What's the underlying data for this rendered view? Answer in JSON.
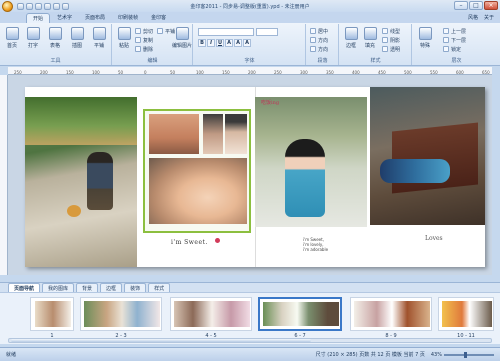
{
  "window": {
    "title": "金印客2011 - 同步易-调整版(重置).ypd - 未注册用户",
    "minimize": "–",
    "maximize": "□",
    "close": "×"
  },
  "tabs": [
    {
      "label": "开始",
      "active": true
    },
    {
      "label": "艺术字",
      "active": false
    },
    {
      "label": "页面布局",
      "active": false
    },
    {
      "label": "印刷装帧",
      "active": false
    },
    {
      "label": "金印客",
      "active": false
    }
  ],
  "tab_right": {
    "style": "风格",
    "about": "关于"
  },
  "ribbon": {
    "groups": {
      "tools": "工具",
      "edit": "编辑",
      "font": "字体",
      "paragraph": "段落",
      "style": "样式",
      "layer": "层次"
    },
    "buttons": {
      "home": "首页",
      "print": "打字",
      "table": "表格",
      "image": "插图",
      "flat": "平铺",
      "paste": "粘贴",
      "cut": "剪切",
      "copy": "复制",
      "delete": "删除",
      "tile": "平铺",
      "edit_image": "编辑图片",
      "center": "居中",
      "left": "方向",
      "right": "方向",
      "border": "边框",
      "fill": "填充",
      "line": "线型",
      "shadow": "阴影",
      "opacity": "透明",
      "special": "特殊",
      "up": "上一层",
      "down": "下一层",
      "lock": "锁定",
      "more": "更多"
    },
    "font_family": "",
    "font_size": ""
  },
  "ruler": {
    "ticks": [
      "250",
      "200",
      "150",
      "100",
      "50",
      "0",
      "50",
      "100",
      "150",
      "200",
      "250",
      "300",
      "350",
      "400",
      "450",
      "500",
      "550",
      "600",
      "650"
    ]
  },
  "canvas": {
    "heading_center": "吃饭ing",
    "caption_mid": "i'm Sweet.",
    "center_lines": [
      "i'm Sweet,",
      "i'm lovely,",
      "i'm adorable"
    ],
    "right_art": "Loves"
  },
  "panel_tabs": [
    {
      "label": "页面导航",
      "active": true
    },
    {
      "label": "我的图库",
      "active": false
    },
    {
      "label": "背景",
      "active": false
    },
    {
      "label": "边框",
      "active": false
    },
    {
      "label": "装饰",
      "active": false
    },
    {
      "label": "样式",
      "active": false
    }
  ],
  "thumbnails": [
    {
      "label": "1"
    },
    {
      "label": "2 - 3"
    },
    {
      "label": "4 - 5"
    },
    {
      "label": "6 - 7",
      "selected": true
    },
    {
      "label": "8 - 9"
    },
    {
      "label": "10 - 11"
    }
  ],
  "status": {
    "left": "就绪",
    "info": "尺寸 (210 × 285)    页数 共 12 页    模板 当前 7 页",
    "zoom": "43%"
  }
}
